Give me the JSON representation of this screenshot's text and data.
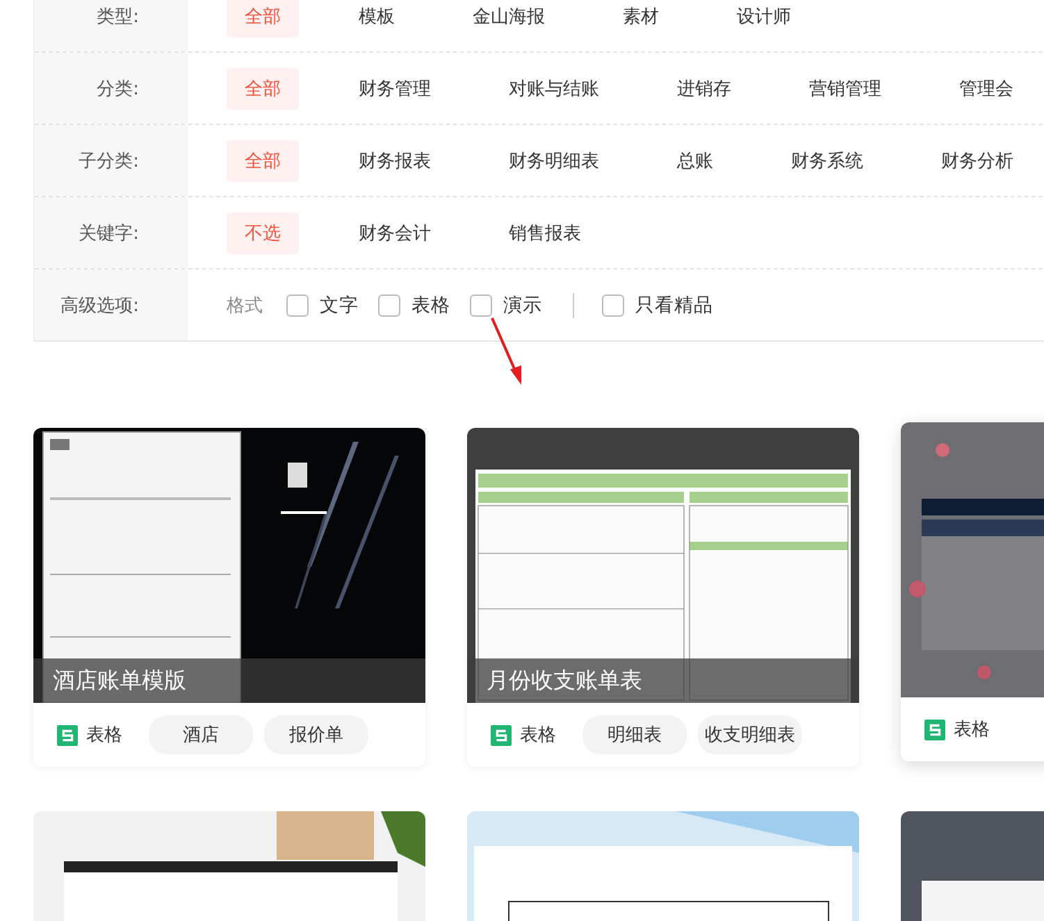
{
  "filters": [
    {
      "label": "类型:",
      "options": [
        {
          "text": "全部",
          "selected": true
        },
        {
          "text": "模板",
          "selected": false
        },
        {
          "text": "金山海报",
          "selected": false
        },
        {
          "text": "素材",
          "selected": false
        },
        {
          "text": "设计师",
          "selected": false
        }
      ]
    },
    {
      "label": "分类:",
      "options": [
        {
          "text": "全部",
          "selected": true
        },
        {
          "text": "财务管理",
          "selected": false
        },
        {
          "text": "对账与结账",
          "selected": false
        },
        {
          "text": "进销存",
          "selected": false
        },
        {
          "text": "营销管理",
          "selected": false
        },
        {
          "text": "管理会",
          "selected": false
        }
      ]
    },
    {
      "label": "子分类:",
      "options": [
        {
          "text": "全部",
          "selected": true
        },
        {
          "text": "财务报表",
          "selected": false
        },
        {
          "text": "财务明细表",
          "selected": false
        },
        {
          "text": "总账",
          "selected": false
        },
        {
          "text": "财务系统",
          "selected": false
        },
        {
          "text": "财务分析",
          "selected": false
        }
      ]
    },
    {
      "label": "关键字:",
      "options": [
        {
          "text": "不选",
          "selected": true
        },
        {
          "text": "财务会计",
          "selected": false
        },
        {
          "text": "销售报表",
          "selected": false
        }
      ]
    }
  ],
  "advanced": {
    "label": "高级选项:",
    "format_label": "格式",
    "formats": [
      {
        "text": "文字",
        "checked": false
      },
      {
        "text": "表格",
        "checked": false
      },
      {
        "text": "演示",
        "checked": false
      }
    ],
    "premium": {
      "text": "只看精品",
      "checked": false
    }
  },
  "cards": [
    {
      "caption": "酒店账单模版",
      "type": "表格",
      "tags": [
        "酒店",
        "报价单"
      ]
    },
    {
      "caption": "月份收支账单表",
      "type": "表格",
      "tags": [
        "明细表",
        "收支明细表"
      ]
    },
    {
      "type": "表格"
    }
  ]
}
